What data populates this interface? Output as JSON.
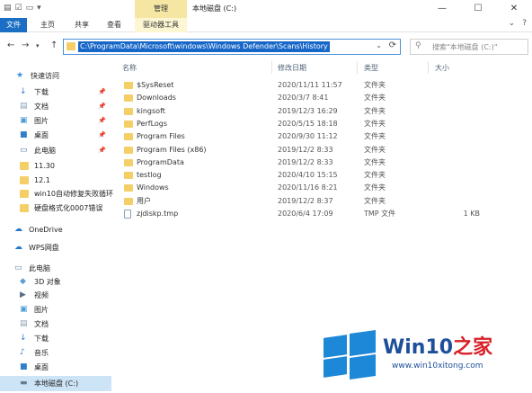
{
  "window": {
    "title": "本地磁盘 (C:)",
    "context_group": "管理",
    "controls": {
      "minimize": "—",
      "maximize": "☐",
      "close": "✕"
    }
  },
  "ribbon": {
    "tabs": [
      "文件",
      "主页",
      "共享",
      "查看",
      "驱动器工具"
    ]
  },
  "address": {
    "path": "C:\\ProgramData\\Microsoft\\windows\\Windows Defender\\Scans\\History",
    "search_placeholder": "搜索\"本地磁盘 (C:)\""
  },
  "nav": {
    "items": [
      {
        "label": "快速访问",
        "icon": "star-icon",
        "pinned": false
      },
      {
        "label": "下载",
        "icon": "download-icon",
        "pinned": true
      },
      {
        "label": "文档",
        "icon": "document-icon",
        "pinned": true
      },
      {
        "label": "图片",
        "icon": "picture-icon",
        "pinned": true
      },
      {
        "label": "桌面",
        "icon": "desktop-icon",
        "pinned": true
      },
      {
        "label": "此电脑",
        "icon": "computer-icon",
        "pinned": true
      },
      {
        "label": "11.30",
        "icon": "folder-icon",
        "pinned": false
      },
      {
        "label": "12.1",
        "icon": "folder-icon",
        "pinned": false
      },
      {
        "label": "win10自动修复失败循环",
        "icon": "folder-icon",
        "pinned": false
      },
      {
        "label": "硬盘格式化0007错误",
        "icon": "folder-icon",
        "pinned": false
      },
      {
        "label": "OneDrive",
        "icon": "cloud-icon",
        "pinned": false
      },
      {
        "label": "WPS网盘",
        "icon": "cloud-icon",
        "pinned": false
      },
      {
        "label": "此电脑",
        "icon": "computer-icon",
        "pinned": false
      },
      {
        "label": "3D 对象",
        "icon": "cube-icon",
        "pinned": false
      },
      {
        "label": "视频",
        "icon": "video-icon",
        "pinned": false
      },
      {
        "label": "图片",
        "icon": "picture-icon",
        "pinned": false
      },
      {
        "label": "文档",
        "icon": "document-icon",
        "pinned": false
      },
      {
        "label": "下载",
        "icon": "download-icon",
        "pinned": false
      },
      {
        "label": "音乐",
        "icon": "music-icon",
        "pinned": false
      },
      {
        "label": "桌面",
        "icon": "desktop-icon",
        "pinned": false
      },
      {
        "label": "本地磁盘 (C:)",
        "icon": "drive-icon",
        "pinned": false,
        "selected": true
      }
    ]
  },
  "columns": [
    "名称",
    "修改日期",
    "类型",
    "大小"
  ],
  "files": [
    {
      "name": "$SysReset",
      "date": "2020/11/11 11:57",
      "type": "文件夹",
      "size": "",
      "kind": "folder"
    },
    {
      "name": "Downloads",
      "date": "2020/3/7 8:41",
      "type": "文件夹",
      "size": "",
      "kind": "folder"
    },
    {
      "name": "kingsoft",
      "date": "2019/12/3 16:29",
      "type": "文件夹",
      "size": "",
      "kind": "folder"
    },
    {
      "name": "PerfLogs",
      "date": "2020/5/15 18:18",
      "type": "文件夹",
      "size": "",
      "kind": "folder"
    },
    {
      "name": "Program Files",
      "date": "2020/9/30 11:12",
      "type": "文件夹",
      "size": "",
      "kind": "folder"
    },
    {
      "name": "Program Files (x86)",
      "date": "2019/12/2 8:33",
      "type": "文件夹",
      "size": "",
      "kind": "folder"
    },
    {
      "name": "ProgramData",
      "date": "2019/12/2 8:33",
      "type": "文件夹",
      "size": "",
      "kind": "folder"
    },
    {
      "name": "testlog",
      "date": "2020/4/10 15:15",
      "type": "文件夹",
      "size": "",
      "kind": "folder"
    },
    {
      "name": "Windows",
      "date": "2020/11/16 8:21",
      "type": "文件夹",
      "size": "",
      "kind": "folder"
    },
    {
      "name": "用户",
      "date": "2019/12/2 8:37",
      "type": "文件夹",
      "size": "",
      "kind": "folder"
    },
    {
      "name": "zjdiskp.tmp",
      "date": "2020/6/4 17:09",
      "type": "TMP 文件",
      "size": "1 KB",
      "kind": "file"
    }
  ],
  "watermark": {
    "brand_main": "Win10",
    "brand_accent": "之家",
    "url": "www.win10xitong.com"
  },
  "colors": {
    "accent": "#1a6fc4",
    "folder": "#f4cf68",
    "selection": "#cde4f7",
    "context_tab": "#f5e7a3"
  }
}
